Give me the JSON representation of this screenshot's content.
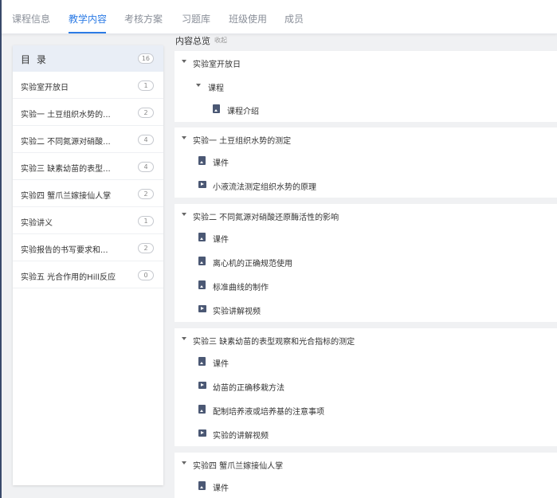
{
  "tabs": [
    {
      "label": "课程信息"
    },
    {
      "label": "教学内容"
    },
    {
      "label": "考核方案"
    },
    {
      "label": "习题库"
    },
    {
      "label": "班级使用"
    },
    {
      "label": "成员"
    }
  ],
  "active_tab": "教学内容",
  "catalog": {
    "title": "目 录",
    "count": "16",
    "items": [
      {
        "label": "实验室开放日",
        "count": "1"
      },
      {
        "label": "实验一 土豆组织水势的...",
        "count": "2"
      },
      {
        "label": "实验二 不同氮源对硝酸...",
        "count": "4"
      },
      {
        "label": "实验三 缺素幼苗的表型...",
        "count": "4"
      },
      {
        "label": "实验四 蟹爪兰嫁接仙人掌",
        "count": "2"
      },
      {
        "label": "实验讲义",
        "count": "1"
      },
      {
        "label": "实验报告的书写要求和...",
        "count": "2"
      },
      {
        "label": "实验五 光合作用的Hill反应",
        "count": "0"
      }
    ]
  },
  "overview": {
    "title": "内容总览",
    "collapse": "收起"
  },
  "sections": [
    {
      "title": "实验室开放日",
      "rows": [
        {
          "type": "folder",
          "label": "课程"
        },
        {
          "type": "file",
          "label": "课程介绍"
        }
      ]
    },
    {
      "title": "实验一 土豆组织水势的测定",
      "rows": [
        {
          "type": "file",
          "label": "课件"
        },
        {
          "type": "video",
          "label": "小液流法测定组织水势的原理"
        }
      ]
    },
    {
      "title": "实验二 不同氮源对硝酸还原酶活性的影响",
      "rows": [
        {
          "type": "file",
          "label": "课件"
        },
        {
          "type": "file",
          "label": "离心机的正确规范使用"
        },
        {
          "type": "file",
          "label": "标准曲线的制作"
        },
        {
          "type": "video",
          "label": "实验讲解视频"
        }
      ]
    },
    {
      "title": "实验三 缺素幼苗的表型观察和光合指标的测定",
      "rows": [
        {
          "type": "file",
          "label": "课件"
        },
        {
          "type": "video",
          "label": "幼苗的正确移栽方法"
        },
        {
          "type": "file",
          "label": "配制培养液或培养基的注意事项"
        },
        {
          "type": "video",
          "label": "实验的讲解视频"
        }
      ]
    },
    {
      "title": "实验四 蟹爪兰嫁接仙人掌",
      "rows": [
        {
          "type": "file",
          "label": "课件"
        }
      ]
    }
  ],
  "colors": {
    "accent": "#2c7be5",
    "icon": "#4b5874",
    "background": "#f0f1f3"
  }
}
